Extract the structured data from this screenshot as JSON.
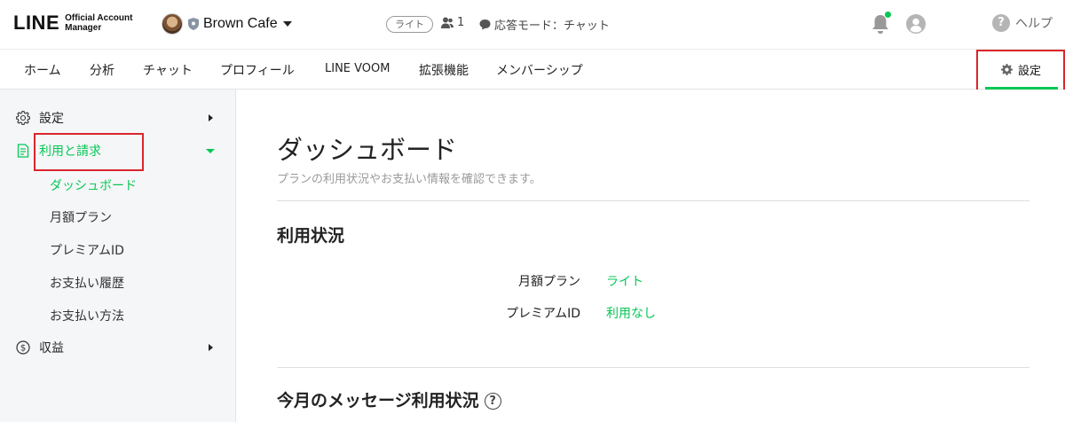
{
  "header": {
    "logo_main": "LINE",
    "logo_sub_1": "Official Account",
    "logo_sub_2": "Manager",
    "account_name": "Brown Cafe",
    "plan_badge": "ライト",
    "friends_count": "1",
    "response_mode": "応答モード：チャット",
    "help_label": "ヘルプ",
    "help_symbol": "?",
    "notification_dot_color": "#06c755"
  },
  "nav": {
    "tabs": [
      "ホーム",
      "分析",
      "チャット",
      "プロフィール",
      "LINE VOOM",
      "拡張機能",
      "メンバーシップ"
    ],
    "settings_label": "設定"
  },
  "sidebar": {
    "items": [
      {
        "label": "設定",
        "icon": "gear-icon"
      },
      {
        "label": "利用と請求",
        "icon": "document-icon"
      },
      {
        "label": "収益",
        "icon": "dollar-icon"
      }
    ],
    "billing_subitems": [
      "ダッシュボード",
      "月額プラン",
      "プレミアムID",
      "お支払い履歴",
      "お支払い方法"
    ]
  },
  "main": {
    "title": "ダッシュボード",
    "subtitle": "プランの利用状況やお支払い情報を確認できます。",
    "usage_section": {
      "title": "利用状況",
      "rows": [
        {
          "label": "月額プラン",
          "value": "ライト"
        },
        {
          "label": "プレミアムID",
          "value": "利用なし"
        }
      ]
    },
    "message_section": {
      "title": "今月のメッセージ利用状況",
      "help_symbol": "?"
    }
  },
  "colors": {
    "accent": "#06c755",
    "highlight_box": "#d9262b",
    "sidebar_bg": "#f5f6f8"
  }
}
